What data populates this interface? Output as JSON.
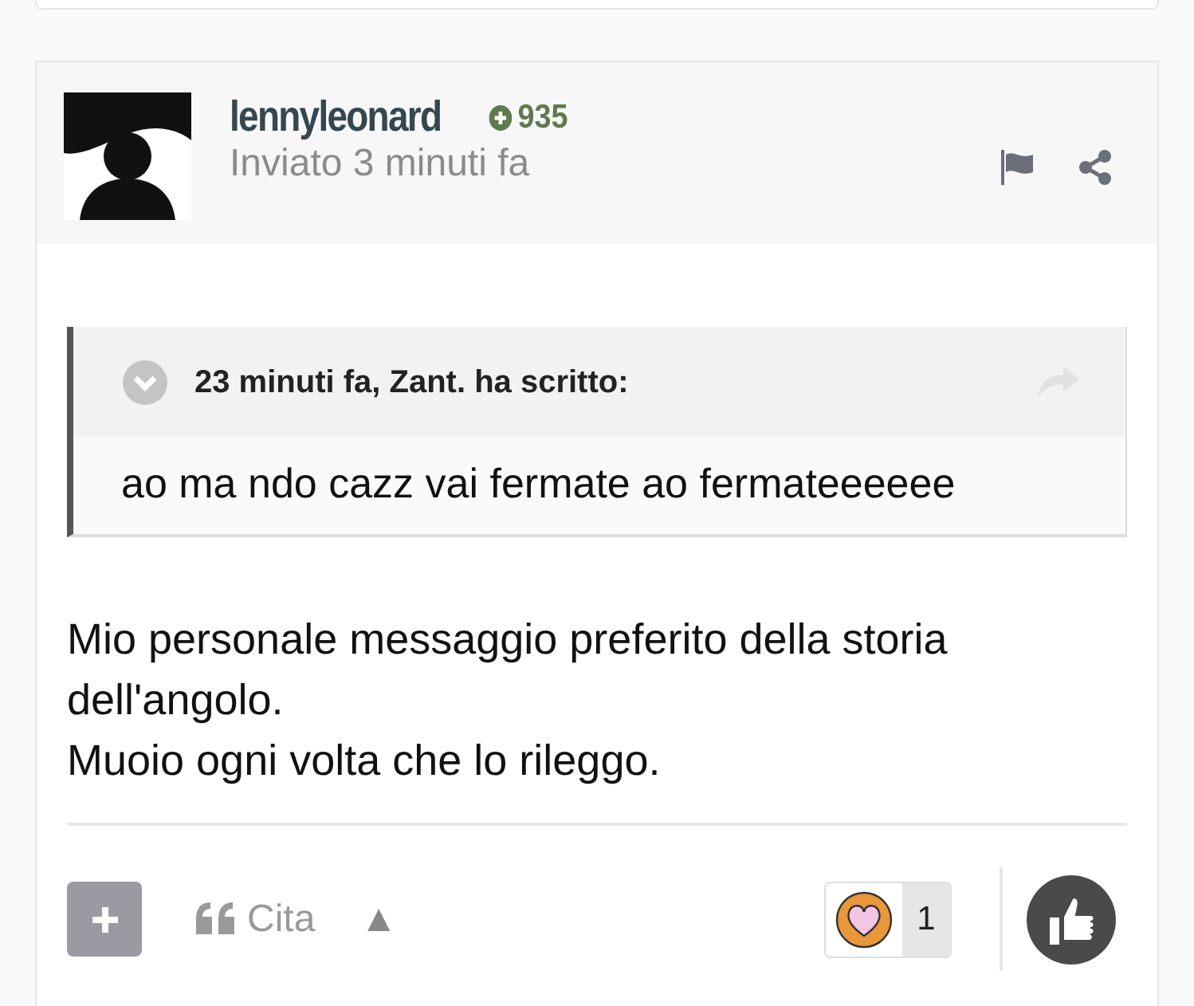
{
  "post": {
    "author": "lennyleonard",
    "reputation": "935",
    "posted": "Inviato 3 minuti fa",
    "quote": {
      "header": "23 minuti fa, Zant. ha scritto:",
      "text": "ao ma ndo cazz vai fermate ao fermateeeeee"
    },
    "paragraphs": [
      "Mio personale messaggio preferito della storia dell'angolo.",
      "Muoio ogni volta che lo rileggo."
    ],
    "footer": {
      "quote_label": "Cita",
      "vote_glyph": "▲",
      "reaction_count": "1"
    }
  }
}
